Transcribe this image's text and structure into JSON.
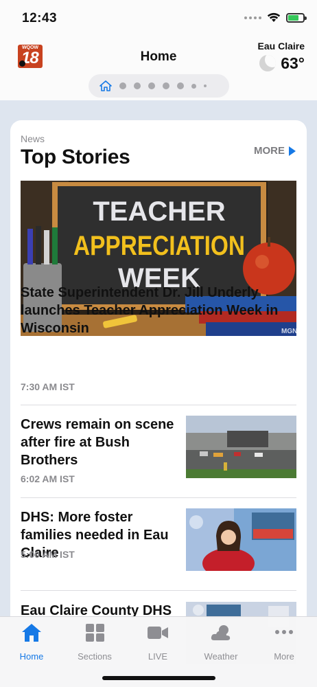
{
  "status_bar": {
    "time": "12:43"
  },
  "header": {
    "logo": {
      "top": "WQOW",
      "number": "18"
    },
    "title": "Home",
    "weather": {
      "city": "Eau Claire",
      "temp": "63°"
    }
  },
  "section": {
    "kicker": "News",
    "title": "Top Stories",
    "more_label": "MORE"
  },
  "hero_story": {
    "image_text": {
      "line1": "TEACHER",
      "line2": "APPRECIATION",
      "line3": "WEEK",
      "credit": "MGN"
    },
    "title": "State Superintendent Dr. Jill Underly launches Teacher Appreciation Week in Wisconsin",
    "time": "7:30 AM IST"
  },
  "stories": [
    {
      "title": "Crews remain on scene after fire at Bush Brothers",
      "time": "6:02 AM IST"
    },
    {
      "title": "DHS: More foster families needed in Eau Claire",
      "time": "5:00 AM IST"
    },
    {
      "title": "Eau Claire County DHS",
      "time": ""
    }
  ],
  "tab_bar": {
    "tabs": [
      {
        "label": "Home",
        "icon": "home-icon"
      },
      {
        "label": "Sections",
        "icon": "grid-icon"
      },
      {
        "label": "LIVE",
        "icon": "video-camera-icon"
      },
      {
        "label": "Weather",
        "icon": "cloud-sun-icon"
      },
      {
        "label": "More",
        "icon": "ellipsis-icon"
      }
    ]
  },
  "colors": {
    "accent": "#1679e6",
    "background": "#dee5ef"
  }
}
